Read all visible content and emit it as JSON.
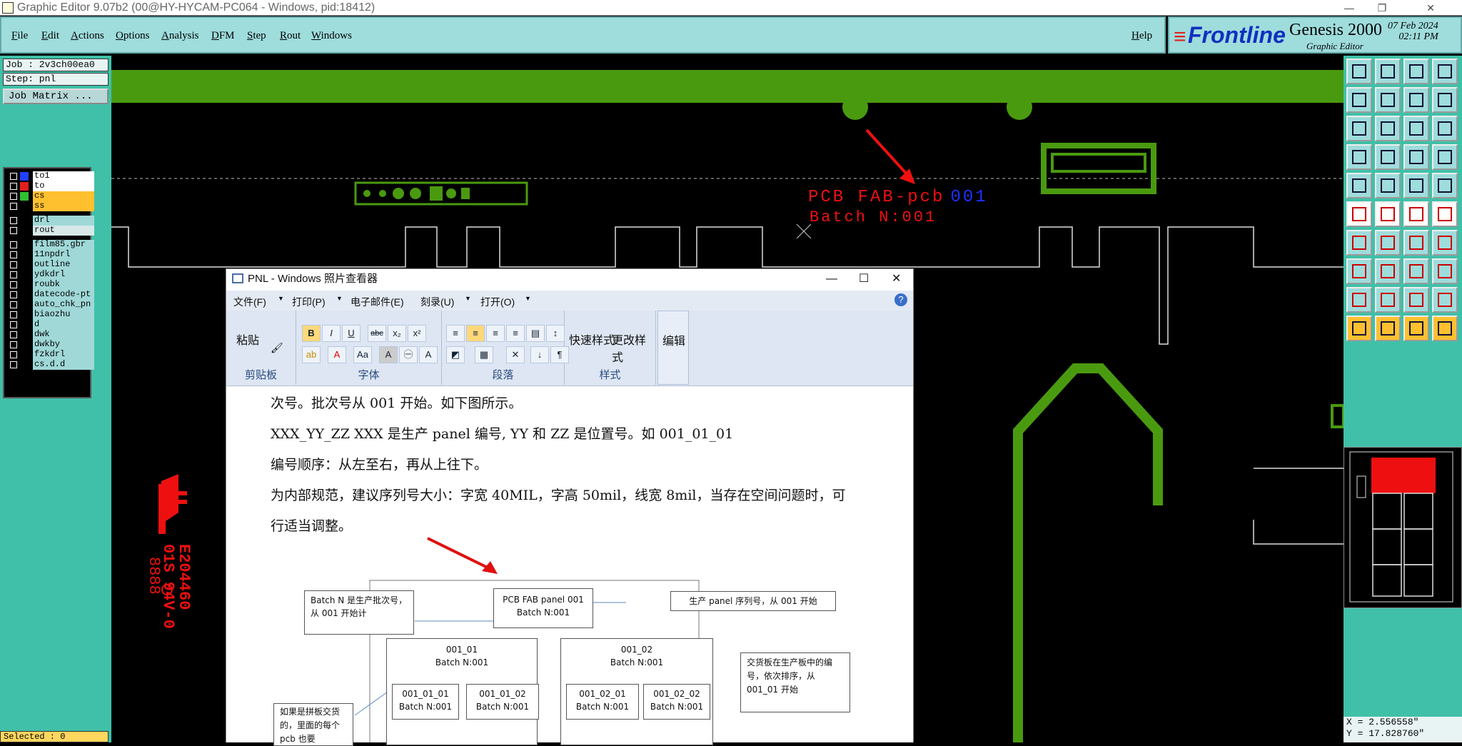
{
  "titlebar": {
    "title": "Graphic Editor 9.07b2 (00@HY-HYCAM-PC064 - Windows, pid:18412)"
  },
  "menu": {
    "items": [
      "File",
      "Edit",
      "Actions",
      "Options",
      "Analysis",
      "DFM",
      "Step",
      "Rout",
      "Windows"
    ],
    "help": "Help"
  },
  "brand": {
    "logo": "Frontline",
    "product": "Genesis 2000",
    "subtitle": "Graphic Editor",
    "date": "07 Feb 2024",
    "time": "02:11 PM"
  },
  "job": {
    "job": "Job : 2v3ch00ea0",
    "step": "Step: pnl",
    "matrix": "Job Matrix ..."
  },
  "layers": [
    {
      "name": "to1",
      "color": "#2040ff",
      "bg": "#ffffff"
    },
    {
      "name": "to",
      "color": "#e02020",
      "bg": "#ffffff"
    },
    {
      "name": "cs",
      "color": "#30c030",
      "bg": "#ffc030"
    },
    {
      "name": "ss",
      "color": "#000000",
      "bg": "#ffc030"
    },
    {
      "name": "drl",
      "color": "#000000",
      "bg": "#a0d8d8"
    },
    {
      "name": "rout",
      "color": "#000000",
      "bg": "#d8e8e8"
    },
    {
      "name": "film85.gbr",
      "color": "#000000",
      "bg": "#a0d8d8"
    },
    {
      "name": "11npdrl",
      "color": "#000000",
      "bg": "#a0d8d8"
    },
    {
      "name": "outline",
      "color": "#000000",
      "bg": "#a0d8d8"
    },
    {
      "name": "ydkdrl",
      "color": "#000000",
      "bg": "#a0d8d8"
    },
    {
      "name": "roubk",
      "color": "#000000",
      "bg": "#a0d8d8"
    },
    {
      "name": "datecode-pt",
      "color": "#000000",
      "bg": "#a0d8d8"
    },
    {
      "name": "auto_chk_pn",
      "color": "#000000",
      "bg": "#a0d8d8"
    },
    {
      "name": "biaozhu",
      "color": "#000000",
      "bg": "#a0d8d8"
    },
    {
      "name": "d",
      "color": "#000000",
      "bg": "#a0d8d8"
    },
    {
      "name": "dwk",
      "color": "#000000",
      "bg": "#a0d8d8"
    },
    {
      "name": "dwkby",
      "color": "#000000",
      "bg": "#a0d8d8"
    },
    {
      "name": "fzkdrl",
      "color": "#000000",
      "bg": "#a0d8d8"
    },
    {
      "name": "cs.d.d",
      "color": "#000000",
      "bg": "#a0d8d8"
    }
  ],
  "status": {
    "selected": "Selected : 0",
    "x": "X = 2.556558\"",
    "y": "Y = 17.828760\""
  },
  "canvas": {
    "label1a": "PCB FAB-pcb",
    "label1b": "001",
    "label2": "Batch N:001",
    "ul_a": "E204460",
    "ul_b": "01S 94V-0",
    "ul_c": "8888"
  },
  "viewer": {
    "title": "PNL - Windows 照片查看器",
    "menu": [
      "文件(F)",
      "打印(P)",
      "电子邮件(E)",
      "刻录(U)",
      "打开(O)"
    ],
    "ribbon": {
      "clipboard": "剪贴板",
      "paste": "粘贴",
      "font": "字体",
      "paragraph": "段落",
      "styles": "样式",
      "quick": "快速样式",
      "change": "更改样式",
      "edit": "编辑"
    },
    "doc": {
      "l1": "次号。批次号从 001 开始。如下图所示。",
      "l2": "XXX_YY_ZZ   XXX 是生产 panel 编号, YY  和   ZZ   是位置号。如 001_01_01",
      "l3": "编号顺序：从左至右，再从上往下。",
      "l4": "为内部规范，建议序列号大小：字宽 40MIL，字高 50mil，线宽 8mil，当存在空间问题时，可",
      "l5": "行适当调整。",
      "b_batch": "Batch  N  是生产批次号，从 001 开始计",
      "b_pcb1": "PCB FAB panel 001",
      "b_pcb2": "Batch N:001",
      "b_serial": "生产 panel  序列号，从 001 开始",
      "b_0101": "001_01",
      "b_0102": "001_02",
      "b_bn": "Batch N:001",
      "b_010101": "001_01_01",
      "b_010102": "001_01_02",
      "b_010201": "001_02_01",
      "b_010202": "001_02_02",
      "b_delivery": "交货板在生产板中的编号，依次排序，从 001_01 开始",
      "b_split": "如果是拼板交货的，里面的每个 pcb 也要"
    }
  }
}
